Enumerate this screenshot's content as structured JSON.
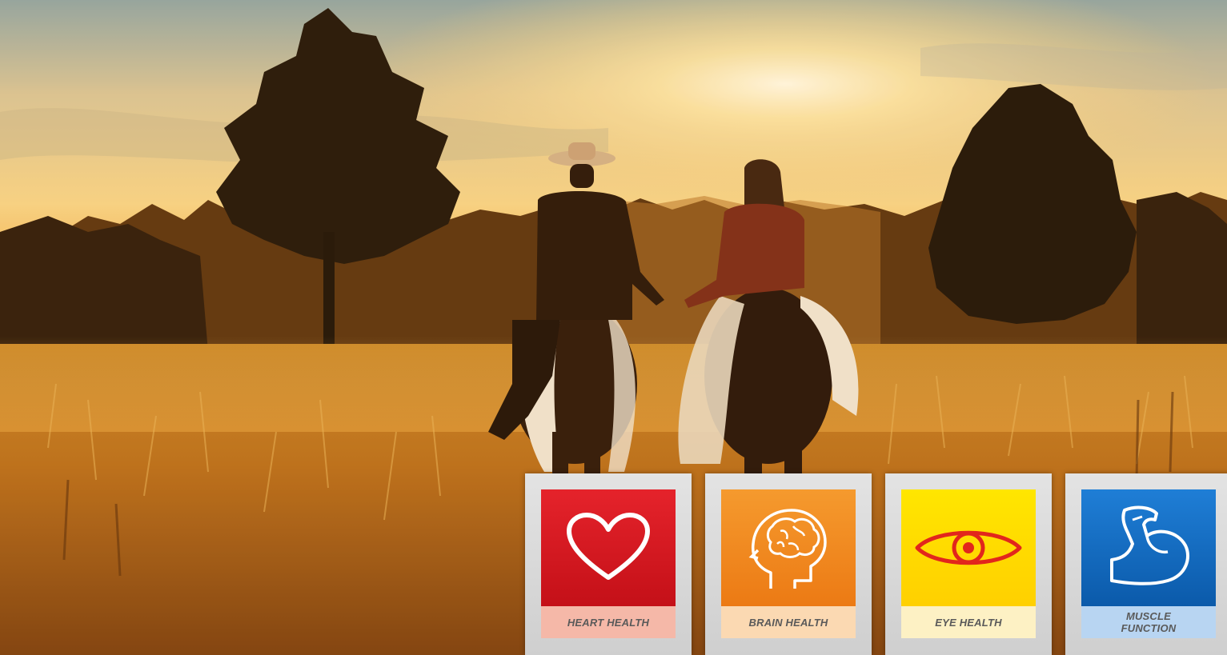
{
  "tiles": [
    {
      "label": "HEART HEALTH",
      "icon": "heart-icon",
      "color": "#d71920"
    },
    {
      "label": "BRAIN HEALTH",
      "icon": "brain-icon",
      "color": "#f08a1f"
    },
    {
      "label": "EYE HEALTH",
      "icon": "eye-icon",
      "color": "#ffdd00"
    },
    {
      "label_line1": "MUSCLE",
      "label_line2": "FUNCTION",
      "icon": "flexed-arm-icon",
      "color": "#0f6cc4"
    }
  ]
}
